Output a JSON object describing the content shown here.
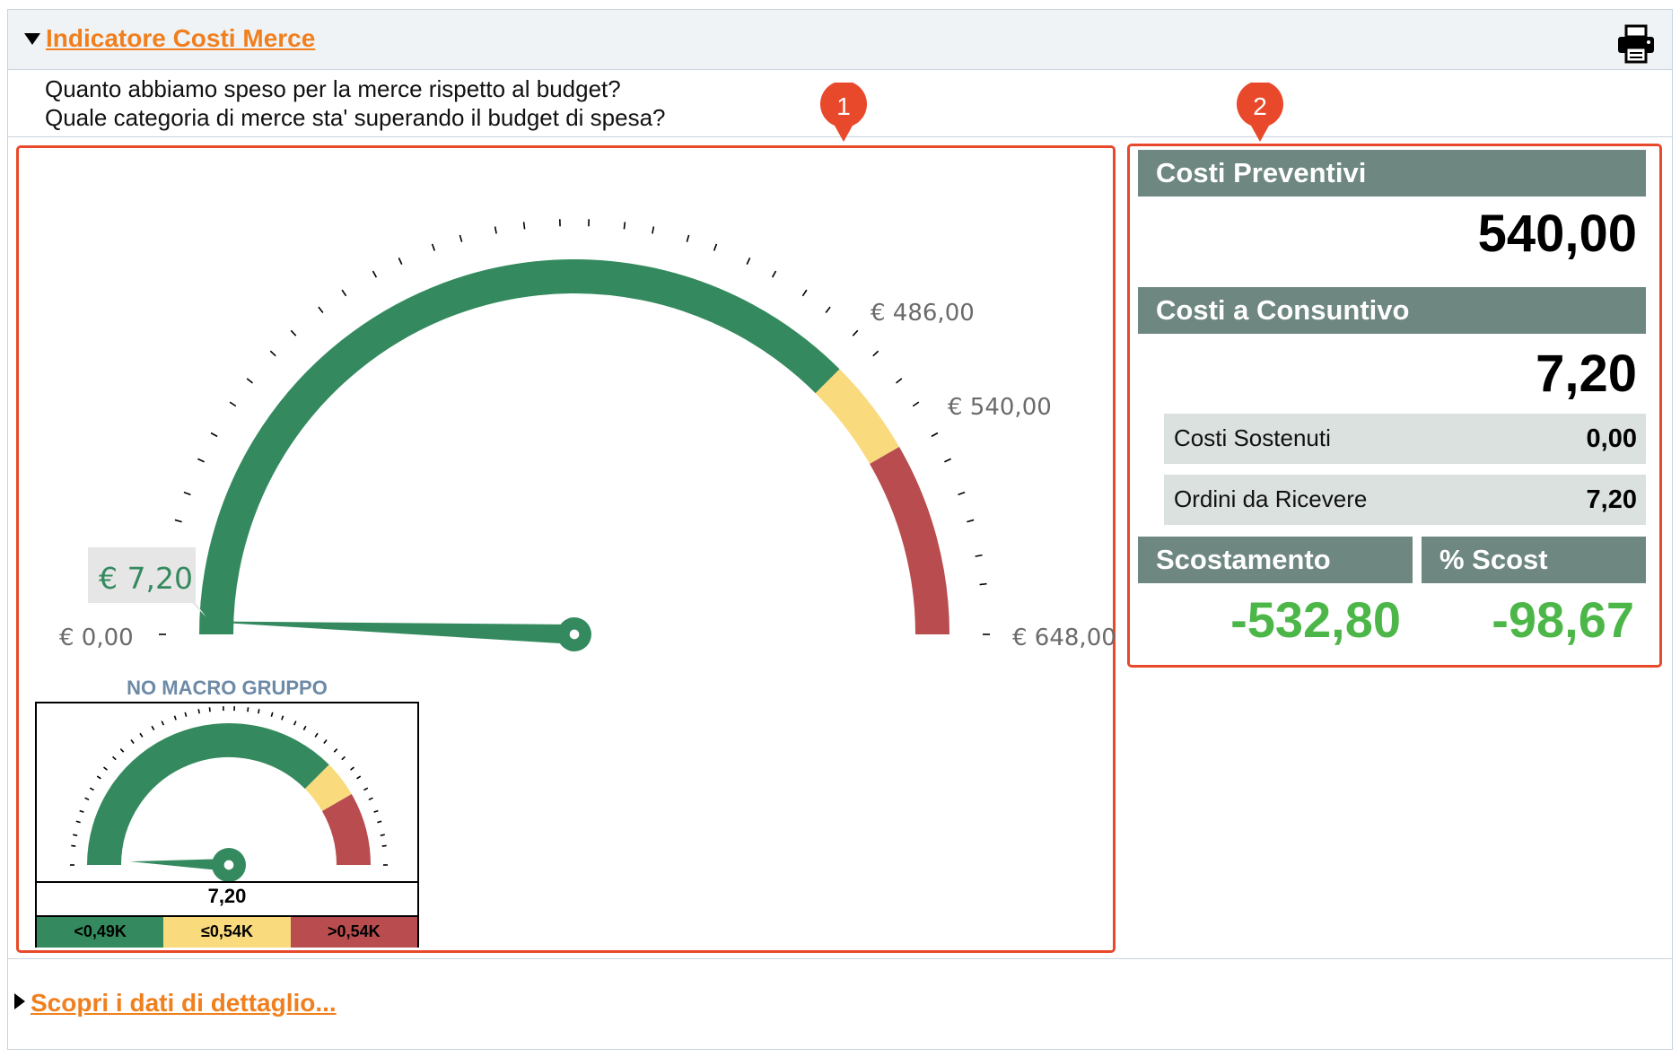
{
  "header": {
    "title": "Indicatore Costi Merce",
    "icons": {
      "collapse": "triangle-down-icon",
      "print": "printer-icon"
    }
  },
  "questions": [
    "Quanto abbiamo speso per la merce rispetto al budget?",
    "Quale categoria di merce sta' superando il budget di spesa?"
  ],
  "markers": [
    "1",
    "2"
  ],
  "colors": {
    "green": "#348a5e",
    "yellow": "#f9db7e",
    "red": "#b84c4f",
    "accent": "#f07f1e",
    "marker": "#e8492a",
    "header_bar": "#6e8780",
    "positive": "#4cb748"
  },
  "chart_data": [
    {
      "type": "gauge",
      "min": 0,
      "max": 648,
      "value": 7.2,
      "bands": [
        {
          "from": 0,
          "to": 486,
          "color": "#348a5e"
        },
        {
          "from": 486,
          "to": 540,
          "color": "#f9db7e"
        },
        {
          "from": 540,
          "to": 648,
          "color": "#b84c4f"
        }
      ],
      "labels": {
        "min": "€ 0,00",
        "max": "€ 648,00",
        "t1": "€ 486,00",
        "t2": "€ 540,00",
        "value": "€ 7,20"
      }
    },
    {
      "type": "gauge",
      "title": "NO MACRO GRUPPO",
      "min": 0,
      "max": 648,
      "value": 7.2,
      "value_label": "7,20",
      "bands": [
        {
          "from": 0,
          "to": 486,
          "color": "#348a5e"
        },
        {
          "from": 486,
          "to": 540,
          "color": "#f9db7e"
        },
        {
          "from": 540,
          "to": 648,
          "color": "#b84c4f"
        }
      ],
      "legend": [
        "<0,49K",
        "≤0,54K",
        ">0,54K"
      ]
    }
  ],
  "summary": {
    "preventivi_label": "Costi Preventivi",
    "preventivi_value": "540,00",
    "consuntivo_label": "Costi a Consuntivo",
    "consuntivo_value": "7,20",
    "rows": [
      {
        "label": "Costi Sostenuti",
        "value": "0,00"
      },
      {
        "label": "Ordini da Ricevere",
        "value": "7,20"
      }
    ],
    "scostamento_label": "Scostamento",
    "scostamento_value": "-532,80",
    "perc_label": "% Scost",
    "perc_value": "-98,67"
  },
  "footer": {
    "link": "Scopri i dati di dettaglio..."
  }
}
